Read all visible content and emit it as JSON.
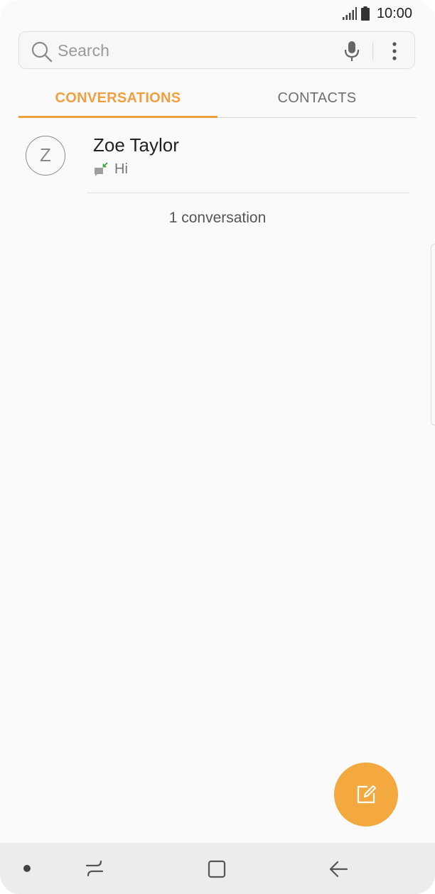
{
  "status_bar": {
    "time": "10:00"
  },
  "search": {
    "placeholder": "Search"
  },
  "tabs": [
    {
      "label": "CONVERSATIONS",
      "active": true
    },
    {
      "label": "CONTACTS",
      "active": false
    }
  ],
  "conversations": [
    {
      "avatar_letter": "Z",
      "name": "Zoe Taylor",
      "preview": "Hi"
    }
  ],
  "conversation_count": "1 conversation",
  "colors": {
    "accent": "#f0a040",
    "fab": "#f3a93f",
    "received_indicator": "#3aa843"
  },
  "icons": {
    "signal": "signal-icon",
    "battery": "battery-icon",
    "search": "search-icon",
    "mic": "mic-icon",
    "more": "more-vert-icon",
    "message_received": "message-received-icon",
    "compose": "compose-icon",
    "nav_recents": "recents-icon",
    "nav_home": "home-icon",
    "nav_back": "back-icon"
  }
}
